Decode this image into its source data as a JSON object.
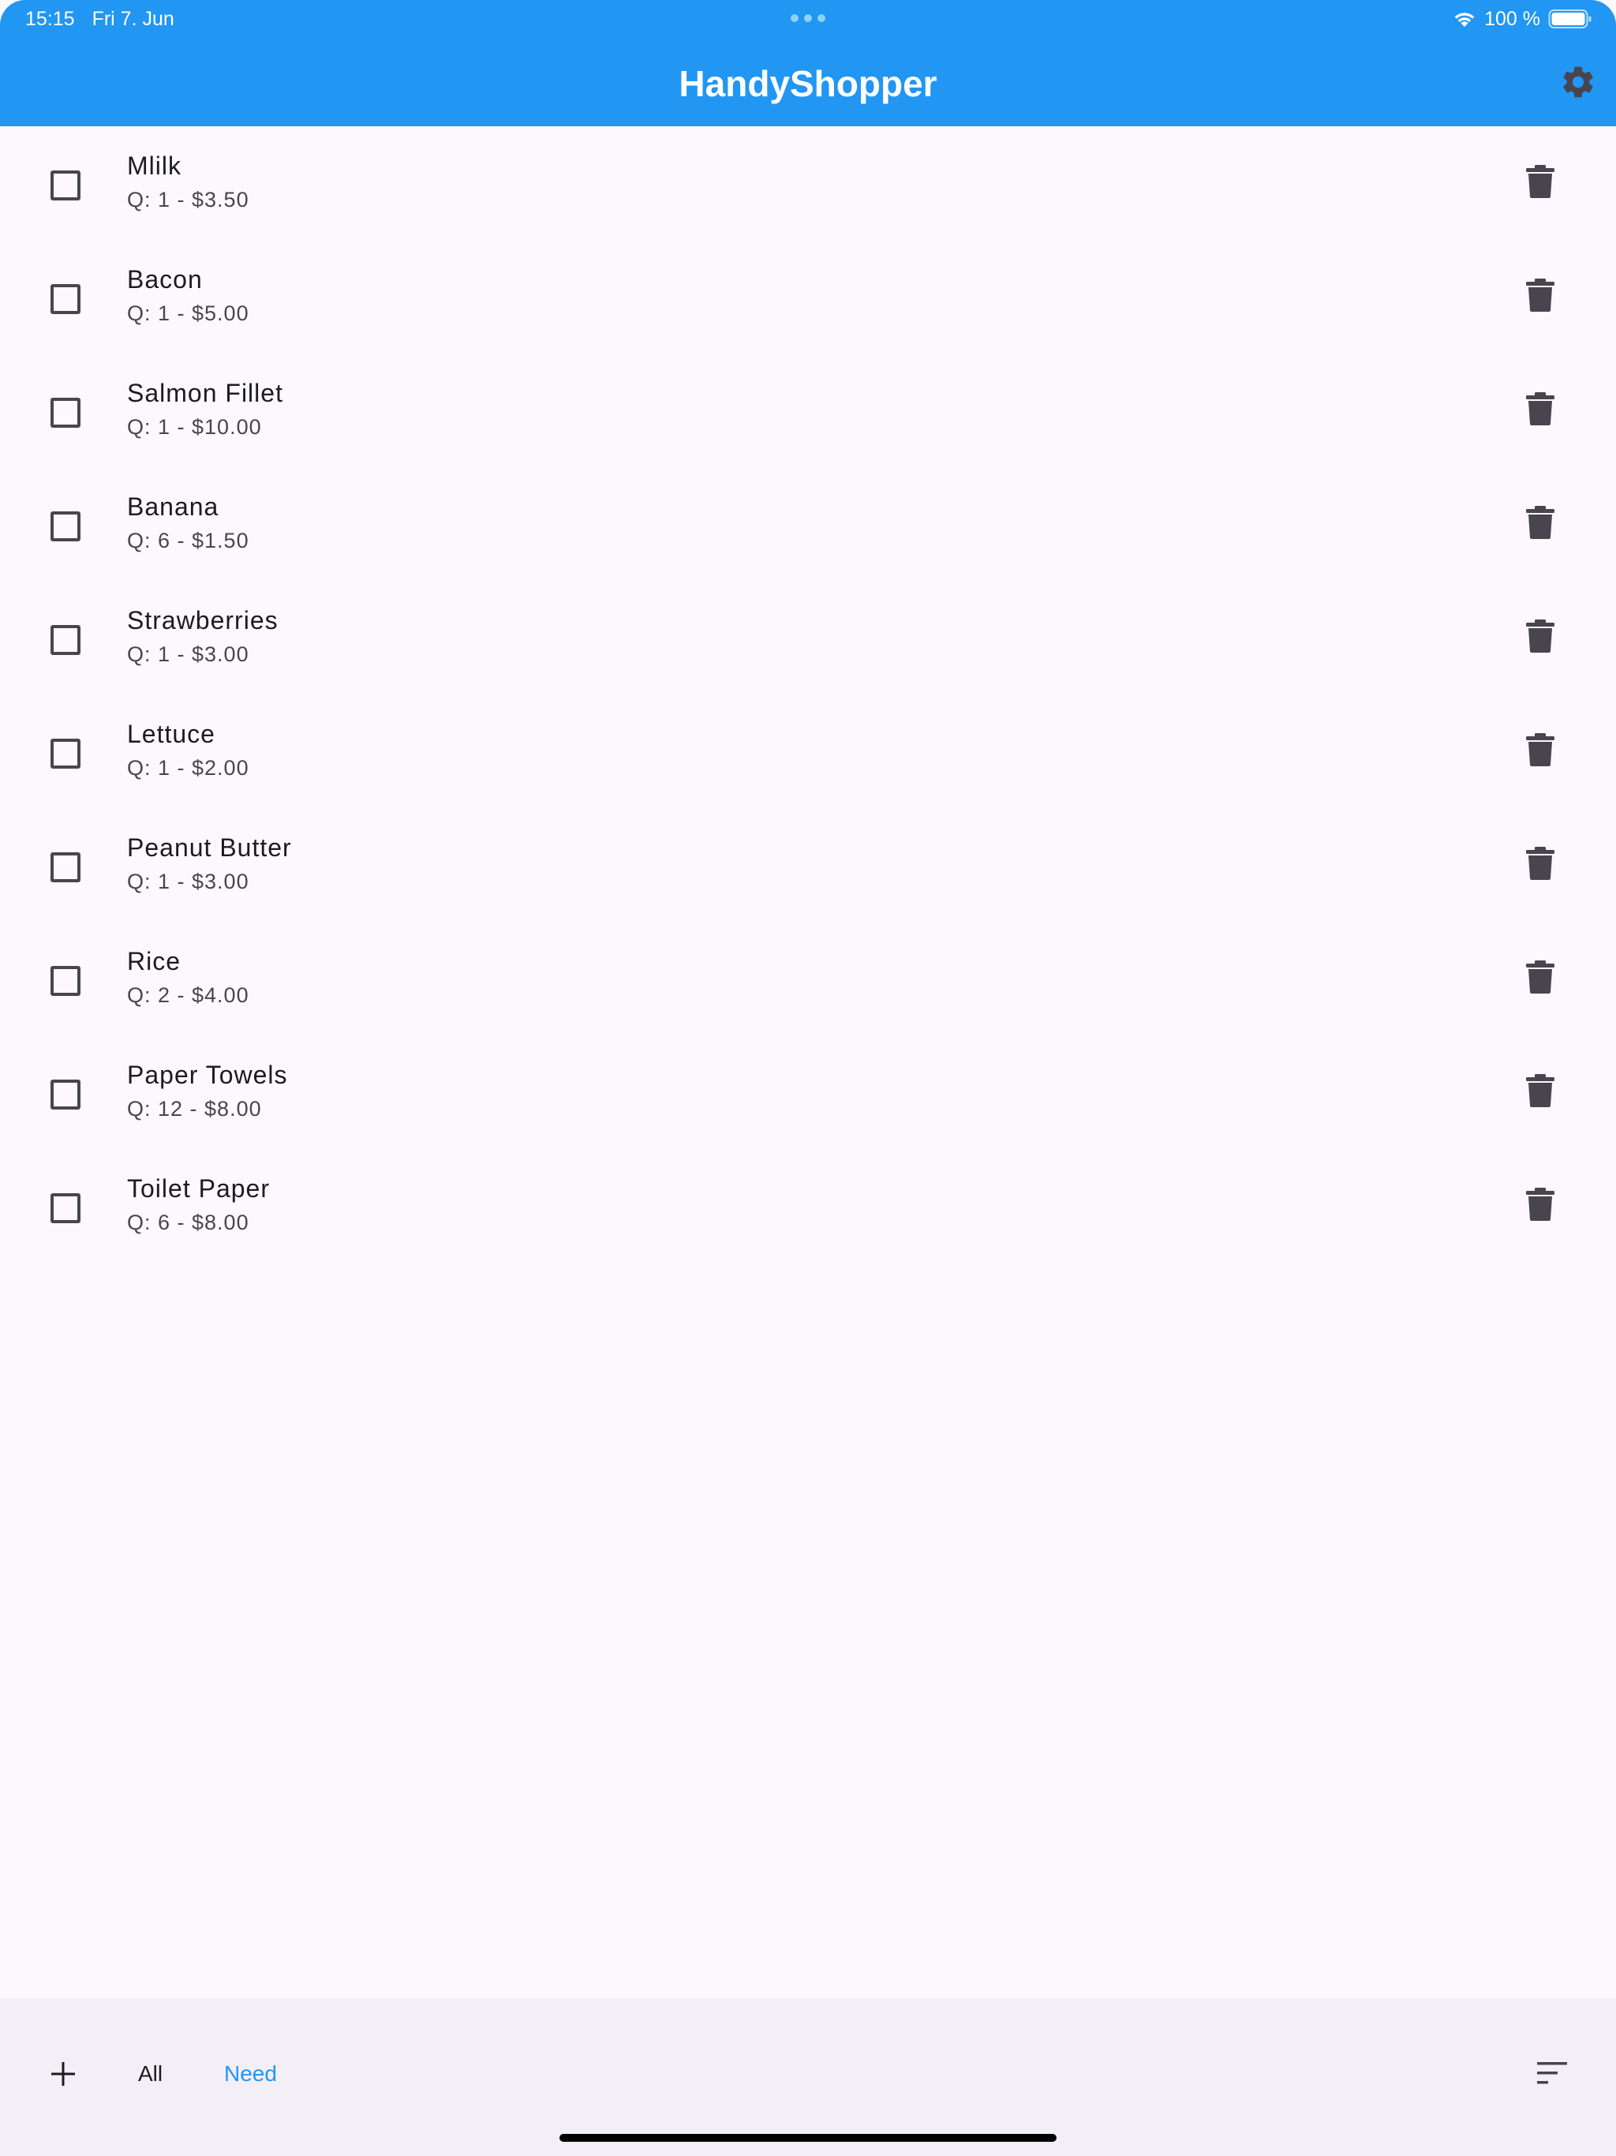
{
  "status_bar": {
    "time": "15:15",
    "date": "Fri 7. Jun",
    "battery": "100 %"
  },
  "app_bar": {
    "title": "HandyShopper",
    "settings_icon": "gear-icon"
  },
  "items": [
    {
      "name": "Mlilk",
      "detail": "Q: 1 - $3.50",
      "checked": false
    },
    {
      "name": "Bacon",
      "detail": "Q: 1 - $5.00",
      "checked": false
    },
    {
      "name": "Salmon Fillet",
      "detail": "Q: 1 - $10.00",
      "checked": false
    },
    {
      "name": "Banana",
      "detail": "Q: 6 - $1.50",
      "checked": false
    },
    {
      "name": "Strawberries",
      "detail": "Q: 1 - $3.00",
      "checked": false
    },
    {
      "name": "Lettuce",
      "detail": "Q: 1 - $2.00",
      "checked": false
    },
    {
      "name": "Peanut Butter",
      "detail": "Q: 1 - $3.00",
      "checked": false
    },
    {
      "name": "Rice",
      "detail": "Q: 2 - $4.00",
      "checked": false
    },
    {
      "name": "Paper Towels",
      "detail": "Q: 12 - $8.00",
      "checked": false
    },
    {
      "name": "Toilet Paper",
      "detail": "Q: 6 - $8.00",
      "checked": false
    }
  ],
  "bottom_bar": {
    "add_icon": "plus-icon",
    "tab_all": "All",
    "tab_need": "Need",
    "active_tab": "Need",
    "sort_icon": "sort-icon"
  },
  "colors": {
    "primary": "#2196f3",
    "background": "#fdf8fd",
    "bottom_bar": "#f3eff7",
    "icon": "#48454e"
  }
}
